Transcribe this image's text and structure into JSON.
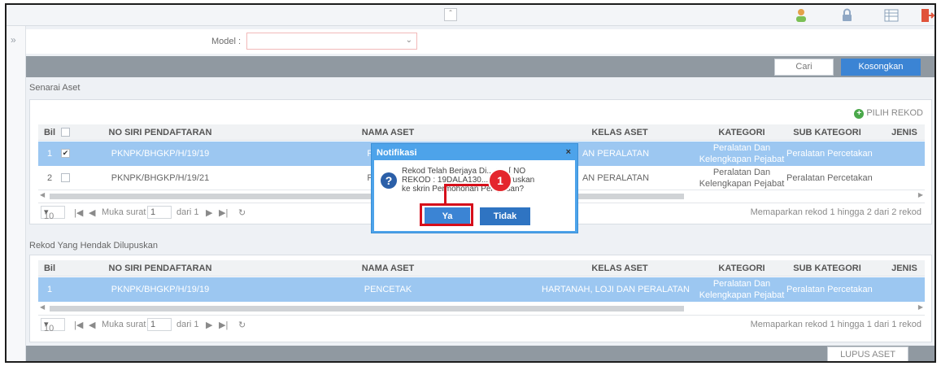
{
  "header": {
    "collapse_glyph": "»",
    "scroll_up_glyph": "§"
  },
  "sidebar": {
    "toggle_glyph": "»"
  },
  "search": {
    "model_label": "Model :",
    "model_value": "",
    "cari_label": "Cari",
    "kosongkan_label": "Kosongkan"
  },
  "senarai": {
    "title": "Senarai Aset",
    "pilih_label": "PILIH REKOD",
    "columns": [
      "Bil",
      "NO SIRI PENDAFTARAN",
      "NAMA ASET",
      "KELAS ASET",
      "KATEGORI",
      "SUB KATEGORI",
      "JENIS"
    ],
    "rows": [
      {
        "bil": "1",
        "checked": "✔",
        "no_siri": "PKNPK/BHGKP/H/19/19",
        "nama": "PENCETA",
        "kelas": "AN PERALATAN",
        "kategori_1": "Peralatan Dan",
        "kategori_2": "Kelengkapan Pejabat",
        "sub": "Peralatan Percetakan",
        "jenis": ""
      },
      {
        "bil": "2",
        "checked": "",
        "no_siri": "PKNPK/BHGKP/H/19/21",
        "nama": "PENCETA",
        "kelas": "AN PERALATAN",
        "kategori_1": "Peralatan Dan",
        "kategori_2": "Kelengkapan Pejabat",
        "sub": "Peralatan Percetakan",
        "jenis": ""
      }
    ],
    "pager": {
      "page_size": "10",
      "page_label": "Muka surat",
      "page_value": "1",
      "of_label": "dari 1",
      "summary": "Memaparkan rekod 1 hingga 2 dari 2 rekod"
    }
  },
  "rekod": {
    "title": "Rekod Yang Hendak Dilupuskan",
    "columns": [
      "Bil",
      "NO SIRI PENDAFTARAN",
      "NAMA ASET",
      "KELAS ASET",
      "KATEGORI",
      "SUB KATEGORI",
      "JENIS"
    ],
    "rows": [
      {
        "bil": "1",
        "no_siri": "PKNPK/BHGKP/H/19/19",
        "nama": "PENCETAK",
        "kelas": "HARTANAH, LOJI DAN PERALATAN",
        "kategori_1": "Peralatan Dan",
        "kategori_2": "Kelengkapan Pejabat",
        "sub": "Peralatan Percetakan",
        "jenis": ""
      }
    ],
    "pager": {
      "page_size": "10",
      "page_label": "Muka surat",
      "page_value": "1",
      "of_label": "dari 1",
      "summary": "Memaparkan rekod 1 hingga 1 dari 1 rekod"
    }
  },
  "footer": {
    "lupus_label": "LUPUS ASET"
  },
  "dialog": {
    "title": "Notifikasi",
    "close": "×",
    "message_line1": "Rekod Telah Berjaya Di... as. [ NO",
    "message_line2": "REKOD : 19DALA130...5 ], Teruskan",
    "message_line3": "ke skrin Permohonan Pelupusan?",
    "icon_glyph": "?",
    "ya_label": "Ya",
    "tidak_label": "Tidak"
  },
  "annotation": {
    "step_number": "1"
  },
  "colors": {
    "accent": "#3b84d4",
    "selected_row": "#9cc7f1",
    "toolbar": "#9099a1",
    "highlight": "#d60f1b"
  }
}
